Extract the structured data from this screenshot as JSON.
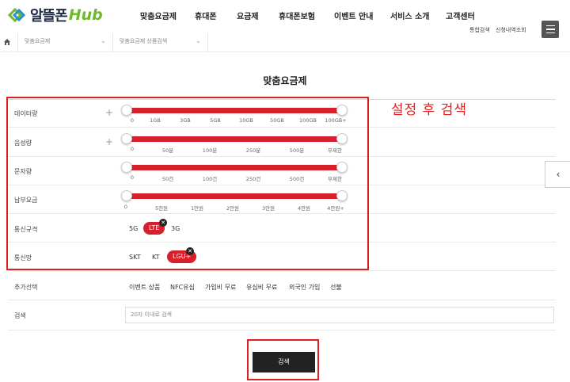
{
  "header": {
    "logo_text": "알뜰폰",
    "logo_hub": "Hub",
    "nav": [
      "맞춤요금제",
      "휴대폰",
      "요금제",
      "휴대폰보험",
      "이벤트 안내",
      "서비스 소개",
      "고객센터"
    ],
    "util_links": [
      "통합검색",
      "신청내역조회"
    ]
  },
  "breadcrumb": {
    "items": [
      "맞춤요금제",
      "맞춤요금제 상품검색"
    ]
  },
  "page_title": "맞춤요금제",
  "annotation": "설정 후 검색",
  "filters": {
    "data": {
      "label": "데이터량",
      "ticks": [
        "0",
        "1GB",
        "3GB",
        "5GB",
        "10GB",
        "50GB",
        "100GB",
        "100GB+"
      ],
      "range": [
        0,
        1
      ]
    },
    "voice": {
      "label": "음성량",
      "ticks": [
        "0",
        "50분",
        "100분",
        "250분",
        "500분",
        "무제한"
      ],
      "range": [
        0,
        1
      ]
    },
    "sms": {
      "label": "문자량",
      "ticks": [
        "0",
        "50건",
        "100건",
        "250건",
        "500건",
        "무제한"
      ],
      "range": [
        0,
        1
      ]
    },
    "fee": {
      "label": "납부요금",
      "ticks": [
        "0",
        "5천원",
        "1만원",
        "2만원",
        "3만원",
        "4만원",
        "4만원+"
      ],
      "range": [
        0,
        1
      ]
    },
    "network": {
      "label": "통신규격",
      "options": [
        "5G",
        "LTE",
        "3G"
      ],
      "selected": "LTE"
    },
    "carrier": {
      "label": "통신망",
      "options": [
        "SKT",
        "KT",
        "LGU+"
      ],
      "selected": "LGU+"
    },
    "extra": {
      "label": "추가선택",
      "options": [
        "이벤트 상품",
        "NFC유심",
        "가입비 무료",
        "유심비 무료",
        "외국인 가입",
        "선불"
      ]
    },
    "search": {
      "label": "검색",
      "placeholder": "20자 이내로 검색"
    }
  },
  "search_button": "검색",
  "icons": {
    "home": "home-icon",
    "menu": "hamburger-icon",
    "prev": "chevron-left-icon",
    "close": "close-icon",
    "plus": "plus-icon"
  },
  "colors": {
    "accent": "#d6202c",
    "annotation": "#e02020",
    "logo_green": "#6fb82c"
  }
}
